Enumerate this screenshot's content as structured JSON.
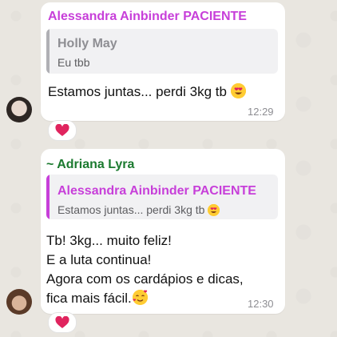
{
  "colors": {
    "alessandra_name": "#c73fd9",
    "adriana_name": "#1b7a2f",
    "holly_name": "#8e8e93",
    "heart": "#e0245e"
  },
  "messages": [
    {
      "sender": "Alessandra Ainbinder PACIENTE",
      "quote": {
        "name": "Holly May",
        "text": "Eu tbb"
      },
      "text": "Estamos juntas... perdi 3kg tb",
      "emoji": "smiling-face-with-heart-eyes",
      "time": "12:29",
      "reaction": "heart"
    },
    {
      "sender": "~ Adriana Lyra",
      "quote": {
        "name": "Alessandra Ainbinder PACIENTE",
        "text": "Estamos juntas... perdi 3kg tb"
      },
      "lines": [
        "Tb! 3kg... muito feliz!",
        "E a luta continua!",
        "Agora com os cardápios e dicas,",
        "fica mais fácil."
      ],
      "emoji": "smiling-face-with-hearts",
      "time": "12:30",
      "reaction": "heart"
    }
  ]
}
